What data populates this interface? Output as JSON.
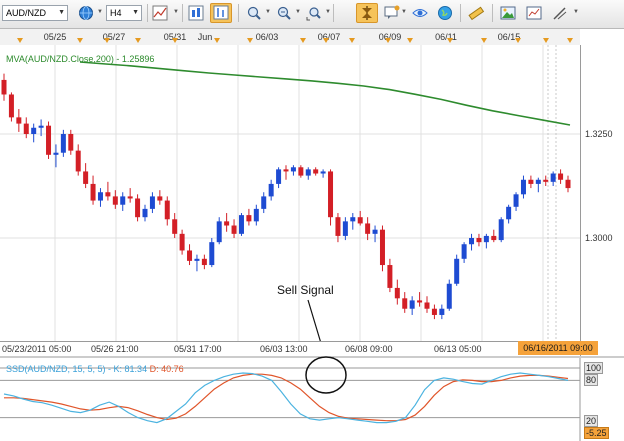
{
  "toolbar": {
    "symbol": "AUD/NZD",
    "timeframe": "H4",
    "icons": [
      "globe-icon",
      "line-chart-icon",
      "chart-type-icon",
      "bar-chart-icon",
      "zoom-in-icon",
      "zoom-out-icon",
      "zoom-fit-icon",
      "pin-icon",
      "comment-icon",
      "eye-icon",
      "globe-alt-icon",
      "ruler-icon",
      "image-icon",
      "panel-icon",
      "draw-tools-icon"
    ]
  },
  "top_dates": [
    "05/25",
    "05/27",
    "05/31",
    "Jun",
    "06/03",
    "06/07",
    "06/09",
    "06/11",
    "06/15"
  ],
  "price_axis": [
    "1.3250",
    "1.3000"
  ],
  "time_axis": [
    "05/23/2011 05:00",
    "05/26 21:00",
    "05/31 17:00",
    "06/03 13:00",
    "06/08 09:00",
    "06/13 05:00"
  ],
  "current_time": "06/16/2011 09:00",
  "ma_label": "MVA(AUD/NZD.Close,200) - 1.25896",
  "indicator": {
    "name": "SSD(AUD/NZD, 15, 5, 5) -",
    "k_text": "K: 81.34",
    "d_text": "D: 40.76",
    "ticks": [
      "100",
      "80",
      "20",
      "-5.25"
    ]
  },
  "annotation": "Sell Signal",
  "colors": {
    "bull": "#1e4bd2",
    "bear": "#d31f26",
    "ma": "#2e8b2e",
    "k_line": "#4bb3e0",
    "d_line": "#e0552a",
    "accent": "#f5a23a"
  },
  "chart_data": {
    "type": "candlestick",
    "title": "",
    "ma_value": 1.25896,
    "ylim": [
      1.28,
      1.36
    ],
    "yticks": [
      1.325,
      1.3
    ],
    "candles": [
      [
        1.338,
        1.3395,
        1.333,
        1.3345
      ],
      [
        1.3345,
        1.335,
        1.328,
        1.329
      ],
      [
        1.329,
        1.331,
        1.3255,
        1.3275
      ],
      [
        1.3275,
        1.329,
        1.324,
        1.325
      ],
      [
        1.325,
        1.3275,
        1.323,
        1.3265
      ],
      [
        1.3265,
        1.3285,
        1.3245,
        1.327
      ],
      [
        1.327,
        1.328,
        1.319,
        1.32
      ],
      [
        1.32,
        1.3225,
        1.317,
        1.3205
      ],
      [
        1.3205,
        1.326,
        1.3195,
        1.325
      ],
      [
        1.325,
        1.326,
        1.32,
        1.321
      ],
      [
        1.321,
        1.3225,
        1.315,
        1.316
      ],
      [
        1.316,
        1.318,
        1.312,
        1.313
      ],
      [
        1.313,
        1.315,
        1.308,
        1.309
      ],
      [
        1.309,
        1.312,
        1.3075,
        1.311
      ],
      [
        1.311,
        1.3135,
        1.309,
        1.31
      ],
      [
        1.31,
        1.3115,
        1.307,
        1.308
      ],
      [
        1.308,
        1.311,
        1.3065,
        1.31
      ],
      [
        1.31,
        1.312,
        1.3085,
        1.3095
      ],
      [
        1.3095,
        1.3105,
        1.304,
        1.305
      ],
      [
        1.305,
        1.308,
        1.304,
        1.307
      ],
      [
        1.307,
        1.311,
        1.306,
        1.31
      ],
      [
        1.31,
        1.3115,
        1.308,
        1.309
      ],
      [
        1.309,
        1.31,
        1.303,
        1.3045
      ],
      [
        1.3045,
        1.306,
        1.3,
        1.301
      ],
      [
        1.301,
        1.302,
        1.296,
        1.297
      ],
      [
        1.297,
        1.2985,
        1.2935,
        1.2945
      ],
      [
        1.2945,
        1.296,
        1.292,
        1.295
      ],
      [
        1.295,
        1.296,
        1.2925,
        1.2935
      ],
      [
        1.2935,
        1.3,
        1.293,
        1.299
      ],
      [
        1.299,
        1.305,
        1.2985,
        1.304
      ],
      [
        1.304,
        1.306,
        1.3015,
        1.303
      ],
      [
        1.303,
        1.3045,
        1.3,
        1.301
      ],
      [
        1.301,
        1.306,
        1.3005,
        1.3055
      ],
      [
        1.3055,
        1.307,
        1.303,
        1.304
      ],
      [
        1.304,
        1.308,
        1.303,
        1.307
      ],
      [
        1.307,
        1.311,
        1.306,
        1.31
      ],
      [
        1.31,
        1.314,
        1.309,
        1.313
      ],
      [
        1.313,
        1.317,
        1.312,
        1.3165
      ],
      [
        1.3165,
        1.3175,
        1.314,
        1.316
      ],
      [
        1.316,
        1.3175,
        1.315,
        1.317
      ],
      [
        1.317,
        1.3175,
        1.3145,
        1.315
      ],
      [
        1.315,
        1.317,
        1.314,
        1.3165
      ],
      [
        1.3165,
        1.317,
        1.315,
        1.3155
      ],
      [
        1.3155,
        1.3165,
        1.3145,
        1.316
      ],
      [
        1.316,
        1.3165,
        1.303,
        1.305
      ],
      [
        1.305,
        1.306,
        1.299,
        1.3005
      ],
      [
        1.3005,
        1.305,
        1.2995,
        1.304
      ],
      [
        1.304,
        1.306,
        1.302,
        1.305
      ],
      [
        1.305,
        1.3065,
        1.303,
        1.3035
      ],
      [
        1.3035,
        1.305,
        1.2995,
        1.301
      ],
      [
        1.301,
        1.303,
        1.299,
        1.302
      ],
      [
        1.302,
        1.303,
        1.292,
        1.2935
      ],
      [
        1.2935,
        1.295,
        1.287,
        1.288
      ],
      [
        1.288,
        1.29,
        1.284,
        1.2855
      ],
      [
        1.2855,
        1.287,
        1.282,
        1.283
      ],
      [
        1.283,
        1.286,
        1.2815,
        1.285
      ],
      [
        1.285,
        1.287,
        1.2835,
        1.2845
      ],
      [
        1.2845,
        1.286,
        1.282,
        1.283
      ],
      [
        1.283,
        1.284,
        1.2805,
        1.2815
      ],
      [
        1.2815,
        1.284,
        1.2805,
        1.283
      ],
      [
        1.283,
        1.29,
        1.2825,
        1.289
      ],
      [
        1.289,
        1.296,
        1.2885,
        1.295
      ],
      [
        1.295,
        1.299,
        1.294,
        1.2985
      ],
      [
        1.2985,
        1.301,
        1.297,
        1.3
      ],
      [
        1.3,
        1.301,
        1.298,
        1.299
      ],
      [
        1.299,
        1.301,
        1.2975,
        1.3005
      ],
      [
        1.3005,
        1.302,
        1.299,
        1.2995
      ],
      [
        1.2995,
        1.305,
        1.299,
        1.3045
      ],
      [
        1.3045,
        1.308,
        1.3035,
        1.3075
      ],
      [
        1.3075,
        1.311,
        1.3065,
        1.3105
      ],
      [
        1.3105,
        1.315,
        1.3095,
        1.314
      ],
      [
        1.314,
        1.315,
        1.312,
        1.313
      ],
      [
        1.313,
        1.3145,
        1.311,
        1.314
      ],
      [
        1.314,
        1.315,
        1.3125,
        1.3135
      ],
      [
        1.3135,
        1.316,
        1.3125,
        1.3155
      ],
      [
        1.3155,
        1.3165,
        1.313,
        1.314
      ],
      [
        1.314,
        1.315,
        1.311,
        1.312
      ]
    ],
    "ma_series": [
      1.356,
      1.3555,
      1.355,
      1.3544,
      1.3538,
      1.3532,
      1.3527,
      1.3522,
      1.3517,
      1.3512,
      1.3506,
      1.3499,
      1.349,
      1.3478,
      1.3465,
      1.345,
      1.3436,
      1.3424,
      1.3412,
      1.34
    ],
    "stoch_k": [
      58,
      55,
      50,
      46,
      44,
      40,
      35,
      30,
      28,
      32,
      40,
      45,
      38,
      28,
      20,
      15,
      12,
      18,
      30,
      42,
      60,
      72,
      80,
      86,
      90,
      92,
      91,
      87,
      80,
      62,
      42,
      26,
      18,
      16,
      18,
      20,
      18,
      16,
      14,
      12,
      12,
      14,
      20,
      40,
      65,
      80,
      84,
      82,
      78,
      75,
      74,
      80,
      86,
      90,
      92,
      90,
      88,
      86,
      83,
      80
    ],
    "stoch_d": [
      52,
      52,
      51,
      49,
      47,
      45,
      42,
      38,
      34,
      32,
      33,
      36,
      38,
      36,
      31,
      25,
      20,
      17,
      19,
      26,
      38,
      52,
      66,
      76,
      84,
      88,
      90,
      90,
      88,
      84,
      76,
      66,
      52,
      38,
      28,
      22,
      19,
      18,
      17,
      16,
      15,
      15,
      17,
      24,
      38,
      56,
      70,
      78,
      81,
      80,
      78,
      78,
      80,
      84,
      87,
      88,
      88,
      87,
      85,
      83
    ],
    "stoch_levels": [
      100,
      80,
      20
    ]
  }
}
